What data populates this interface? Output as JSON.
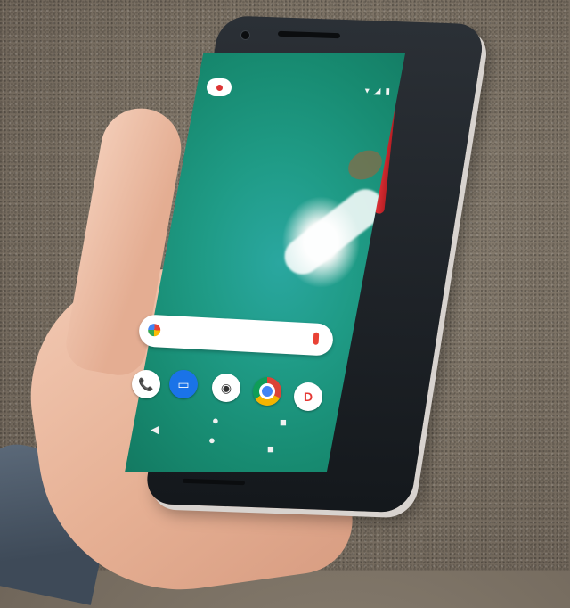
{
  "scene": {
    "subject": "",
    "background": ""
  },
  "screen": {
    "status_bar_text": "",
    "status_bar_secondary": "",
    "wallpaper_colors": [
      "#2aa7a0",
      "#178a70",
      "#f3f7f5"
    ]
  },
  "dock": {
    "apps": [
      {
        "name": "phone",
        "glyph": "📞"
      },
      {
        "name": "messages",
        "glyph": "▭"
      },
      {
        "name": "camera",
        "glyph": "◉"
      },
      {
        "name": "chrome",
        "glyph": ""
      },
      {
        "name": "store",
        "glyph": "D"
      }
    ]
  },
  "navigation": {
    "back": "◀",
    "home": "●",
    "recents": "■"
  },
  "colors": {
    "phone_frame": "#14181c",
    "accent_red": "#e8343a",
    "skin": "#e6b094",
    "sleeve": "#4a5665"
  }
}
